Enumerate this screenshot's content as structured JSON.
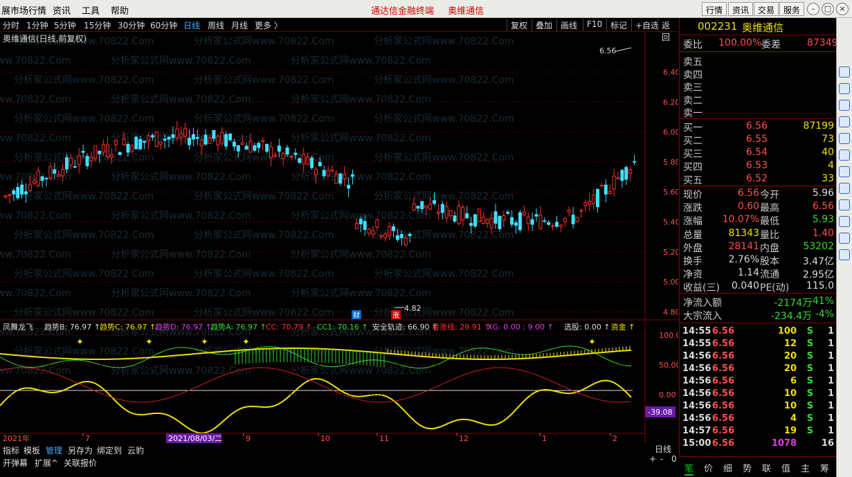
{
  "menu": {
    "items": [
      "展市场行情",
      "资讯",
      "工具",
      "帮助"
    ],
    "center": [
      "通达信金融终端",
      "奥维通信"
    ],
    "right": [
      "行情",
      "资讯",
      "交易",
      "服务"
    ]
  },
  "periods": [
    "分时",
    "1分钟",
    "5分钟",
    "15分钟",
    "30分钟",
    "60分钟",
    "日线",
    "周线",
    "月线",
    "更多 〉"
  ],
  "active_period": "日线",
  "tools": [
    "复权",
    "叠加",
    "画线",
    "F10",
    "标记",
    "+自选",
    "返回"
  ],
  "stock": {
    "code": "002231",
    "name": "奥维通信"
  },
  "chart_title": "奥维通信(日线,前复权)",
  "watermark": "分析家公式网www.70822.Com",
  "price_axis": [
    "6.40",
    "6.20",
    "6.00",
    "5.80",
    "5.60",
    "5.40",
    "5.20",
    "5.00",
    "4.80"
  ],
  "high_label": "6.56",
  "low_label": "4.82",
  "markers": [
    "财",
    "涨"
  ],
  "indicator": {
    "name": "凤舞龙飞",
    "items": [
      {
        "label": "趋势B: 76.97",
        "color": "#ddd"
      },
      {
        "label": "趋势C: 76.97",
        "color": "#f0e000"
      },
      {
        "label": "趋势D: 76.97",
        "color": "#e040e0"
      },
      {
        "label": "趋势A: 76.97",
        "color": "#33dd33"
      },
      {
        "label": "CC: 70.79",
        "color": "#ff3030"
      },
      {
        "label": "CC1: 70.16",
        "color": "#33dd33"
      },
      {
        "label": "安全轨迹: 66.90",
        "color": "#ddd"
      },
      {
        "label": "看涨线: 29.91",
        "color": "#ff3030"
      },
      {
        "label": "XG: 0.00 : 9.00",
        "color": "#e040e0"
      },
      {
        "label": "选股: 0.00",
        "color": "#ddd"
      },
      {
        "label": "资金",
        "color": "#f0e000"
      }
    ],
    "axis": [
      "100.0",
      "50.00",
      "0.00"
    ],
    "current": "-39.08"
  },
  "dates": {
    "year": "2021年",
    "selected": "2021/08/03/二",
    "months": [
      "7",
      "9",
      "10",
      "11",
      "12",
      "1",
      "2"
    ]
  },
  "period_label": "日线",
  "zoom": [
    "+",
    "-",
    "0"
  ],
  "bottom_tabs1": [
    "指标",
    "模板",
    "管理",
    "另存为",
    "绑定到",
    "云豹"
  ],
  "bottom_tabs2": [
    "开弹幕",
    "扩展^",
    "关联报价"
  ],
  "quote": {
    "weibi_label": "委比",
    "weibi": "100.00%",
    "weicha_label": "委差",
    "weicha": "87349",
    "sell": [
      {
        "label": "卖五",
        "price": "",
        "vol": ""
      },
      {
        "label": "卖四",
        "price": "",
        "vol": ""
      },
      {
        "label": "卖三",
        "price": "",
        "vol": ""
      },
      {
        "label": "卖二",
        "price": "",
        "vol": ""
      },
      {
        "label": "卖一",
        "price": "",
        "vol": ""
      }
    ],
    "buy": [
      {
        "label": "买一",
        "price": "6.56",
        "vol": "87199"
      },
      {
        "label": "买二",
        "price": "6.55",
        "vol": "73"
      },
      {
        "label": "买三",
        "price": "6.54",
        "vol": "40"
      },
      {
        "label": "买四",
        "price": "6.53",
        "vol": "4"
      },
      {
        "label": "买五",
        "price": "6.52",
        "vol": "33"
      }
    ],
    "stats": [
      {
        "l1": "现价",
        "v1": "6.56",
        "c1": "red",
        "l2": "今开",
        "v2": "5.96",
        "c2": "wht"
      },
      {
        "l1": "涨跌",
        "v1": "0.60",
        "c1": "red",
        "l2": "最高",
        "v2": "6.56",
        "c2": "red"
      },
      {
        "l1": "涨幅",
        "v1": "10.07%",
        "c1": "red",
        "l2": "最低",
        "v2": "5.93",
        "c2": "grn"
      },
      {
        "l1": "总量",
        "v1": "81343",
        "c1": "yel",
        "l2": "量比",
        "v2": "1.40",
        "c2": "red"
      },
      {
        "l1": "外盘",
        "v1": "28141",
        "c1": "red",
        "l2": "内盘",
        "v2": "53202",
        "c2": "grn"
      },
      {
        "l1": "换手",
        "v1": "2.76%",
        "c1": "wht",
        "l2": "股本",
        "v2": "3.47亿",
        "c2": "wht"
      },
      {
        "l1": "净资",
        "v1": "1.14",
        "c1": "wht",
        "l2": "流通",
        "v2": "2.95亿",
        "c2": "wht"
      },
      {
        "l1": "收益(三)",
        "v1": "0.040",
        "c1": "wht",
        "l2": "PE(动)",
        "v2": "115.0",
        "c2": "wht"
      }
    ],
    "flow": [
      {
        "label": "净流入额",
        "v": "-2174万",
        "p": "-41%"
      },
      {
        "label": "大宗流入",
        "v": "-234.4万",
        "p": "-4%"
      }
    ],
    "ticks": [
      {
        "t": "14:55",
        "p": "6.56",
        "v": "100",
        "s": "S",
        "n": "1"
      },
      {
        "t": "14:55",
        "p": "6.56",
        "v": "12",
        "s": "S",
        "n": "1"
      },
      {
        "t": "14:56",
        "p": "6.56",
        "v": "20",
        "s": "S",
        "n": "1"
      },
      {
        "t": "14:56",
        "p": "6.56",
        "v": "20",
        "s": "S",
        "n": "1"
      },
      {
        "t": "14:56",
        "p": "6.56",
        "v": "6",
        "s": "S",
        "n": "1"
      },
      {
        "t": "14:56",
        "p": "6.56",
        "v": "10",
        "s": "S",
        "n": "1"
      },
      {
        "t": "14:56",
        "p": "6.56",
        "v": "10",
        "s": "S",
        "n": "1"
      },
      {
        "t": "14:56",
        "p": "6.56",
        "v": "4",
        "s": "S",
        "n": "1"
      },
      {
        "t": "14:57",
        "p": "6.56",
        "v": "19",
        "s": "S",
        "n": "1"
      },
      {
        "t": "15:00",
        "p": "6.56",
        "v": "1078",
        "s": "",
        "n": "16"
      }
    ],
    "tabs": [
      "笔",
      "价",
      "细",
      "势",
      "联",
      "值",
      "主",
      "筹"
    ]
  },
  "sidebar_icons": [
    "icon-1",
    "icon-2",
    "icon-3",
    "icon-4",
    "icon-5",
    "icon-6",
    "icon-7",
    "icon-8",
    "icon-9",
    "icon-10",
    "icon-11",
    "icon-12"
  ]
}
